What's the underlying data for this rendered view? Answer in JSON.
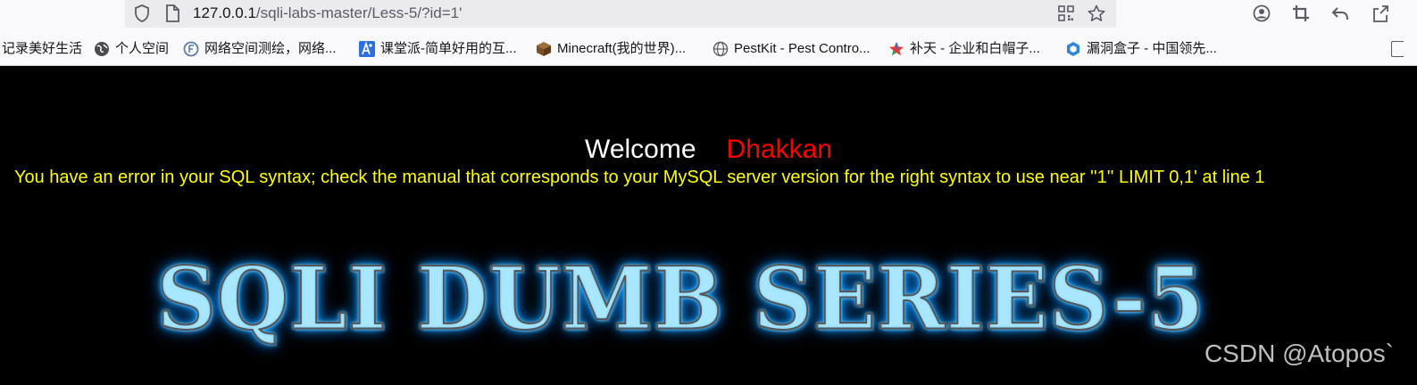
{
  "browser": {
    "url_host": "127.0.0.1",
    "url_path": "/sqli-labs-master/Less-5/?id=1'",
    "bookmarks": [
      {
        "label": "记录美好生活",
        "icon": "page-icon"
      },
      {
        "label": "个人空间",
        "icon": "globe-dark-icon"
      },
      {
        "label": "网络空间测绘，网络...",
        "icon": "fofa-icon"
      },
      {
        "label": "课堂派-简单好用的互...",
        "icon": "ketangpai-icon"
      },
      {
        "label": "Minecraft(我的世界)...",
        "icon": "minecraft-block-icon"
      },
      {
        "label": "PestKit - Pest Contro...",
        "icon": "globe-icon"
      },
      {
        "label": "补天 - 企业和白帽子...",
        "icon": "butian-star-icon"
      },
      {
        "label": "漏洞盒子 - 中国领先...",
        "icon": "vulbox-hexagon-icon"
      }
    ]
  },
  "page": {
    "welcome_word": "Welcome",
    "welcome_name": "Dhakkan",
    "error_message": "You have an error in your SQL syntax; check the manual that corresponds to your MySQL server version for the right syntax to use near ''1'' LIMIT 0,1' at line 1",
    "banner_text": "SQLI DUMB SERIES-5"
  },
  "watermark": "CSDN @Atopos`",
  "colors": {
    "page_background": "#000000",
    "welcome_word": "#ffffff",
    "welcome_name": "#ff0000",
    "error_text": "#ffff00",
    "banner_glow": "#1aa3ff"
  }
}
